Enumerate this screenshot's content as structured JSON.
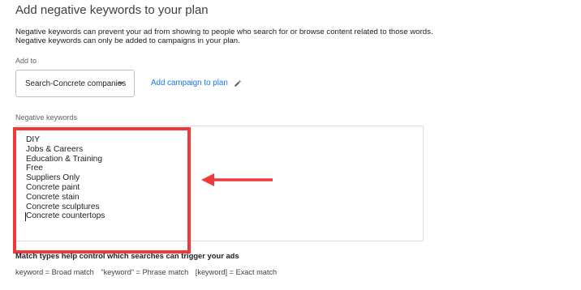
{
  "header": {
    "title": "Add negative keywords to your plan"
  },
  "description": {
    "line1": "Negative keywords can prevent your ad from showing to people who search for or browse content related to those words.",
    "line2": "Negative keywords can only be added to campaigns in your plan."
  },
  "add_to": {
    "label": "Add to",
    "selected_campaign": "Search-Concrete companies",
    "add_campaign_link": "Add campaign to plan"
  },
  "negative_keywords": {
    "label": "Negative keywords",
    "items": [
      "DIY",
      "Jobs & Careers",
      "Education & Training",
      "Free",
      "Suppliers Only",
      "Concrete paint",
      "Concrete stain",
      "Concrete sculptures",
      "Concrete countertops"
    ]
  },
  "match_types": {
    "heading": "Match types help control which searches can trigger your ads",
    "broad": "keyword = Broad match",
    "phrase": "\"keyword\" = Phrase match",
    "exact": "[keyword] = Exact match"
  },
  "colors": {
    "accent_link": "#1a73e8",
    "annotation_red": "#ee3a3a",
    "border": "#dadce0"
  },
  "icons": {
    "dropdown": "caret-down-icon",
    "edit": "pencil-icon",
    "annotation": "arrow-left-icon"
  }
}
